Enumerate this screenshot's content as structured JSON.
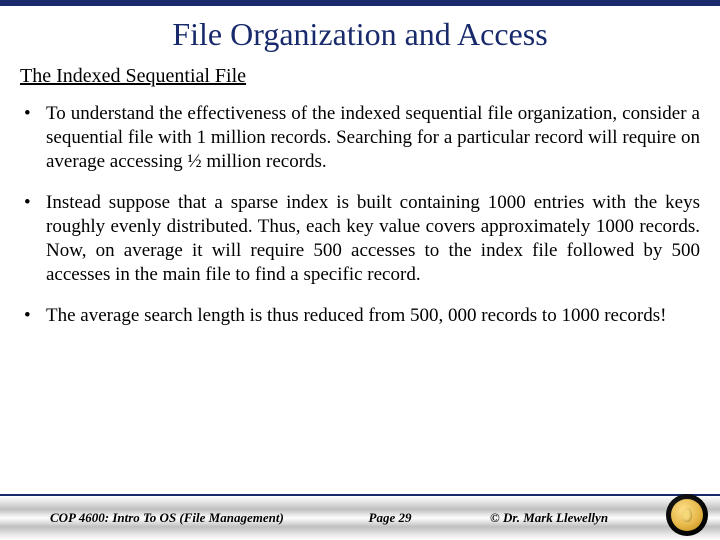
{
  "title": "File Organization and Access",
  "subtitle": "The Indexed Sequential File",
  "bullets": [
    "To understand the effectiveness of the indexed sequential file organization, consider a sequential file with 1 million records.  Searching for a particular record will require on average accessing ½ million records.",
    "Instead suppose that a sparse index is built containing 1000 entries with the keys roughly evenly distributed.  Thus, each key value covers approximately 1000 records.  Now, on average it will require 500 accesses to the index file followed by 500 accesses in the main file to find a specific record.",
    "The average search length is thus reduced from 500, 000 records to 1000 records!"
  ],
  "footer": {
    "left": "COP 4600: Intro To OS  (File Management)",
    "center": "Page 29",
    "right": "© Dr. Mark Llewellyn"
  }
}
